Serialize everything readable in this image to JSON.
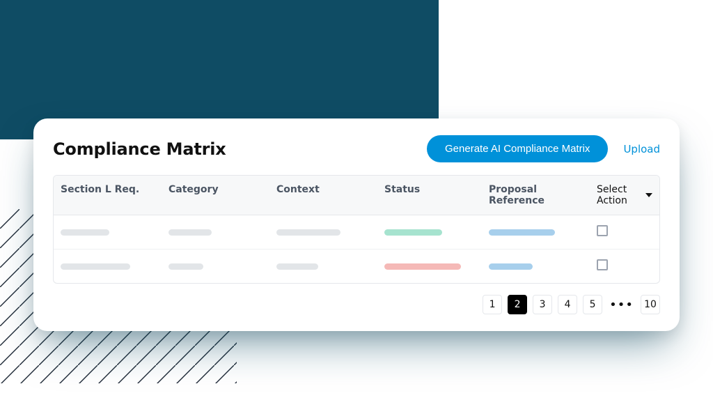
{
  "header": {
    "title": "Compliance Matrix",
    "primary_button": "Generate AI Compliance Matrix",
    "upload_link": "Upload"
  },
  "columns": {
    "section": "Section L Req.",
    "category": "Category",
    "context": "Context",
    "status": "Status",
    "proposal": "Proposal Reference",
    "action": "Select Action"
  },
  "rows": [
    {
      "section_w": 70,
      "category_w": 62,
      "context_w": 92,
      "status_color": "green",
      "status_w": 83,
      "proposal_color": "blue",
      "proposal_w": 95
    },
    {
      "section_w": 100,
      "category_w": 50,
      "context_w": 60,
      "status_color": "pink",
      "status_w": 110,
      "proposal_color": "blue",
      "proposal_w": 63
    }
  ],
  "pagination": {
    "pages": [
      "1",
      "2",
      "3",
      "4",
      "5"
    ],
    "active_index": 1,
    "ellipsis": "•••",
    "last": "10"
  },
  "colors": {
    "teal": "#0F4C64",
    "primary": "#0091D9"
  }
}
